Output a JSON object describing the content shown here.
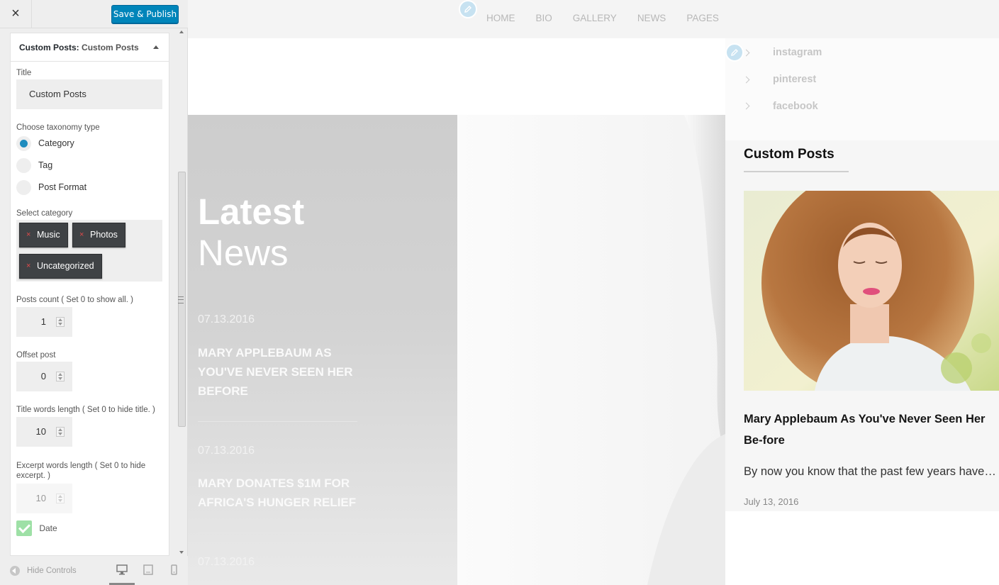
{
  "customizer": {
    "close_icon": "×",
    "publish_label": "Save & Publish",
    "widget_prefix": "Custom Posts:",
    "widget_name": "Custom Posts",
    "title_label": "Title",
    "title_value": "Custom Posts",
    "taxonomy_label": "Choose taxonomy type",
    "taxonomy_options": [
      "Category",
      "Tag",
      "Post Format"
    ],
    "taxonomy_selected": "Category",
    "category_label": "Select category",
    "categories": [
      "Music",
      "Photos",
      "Uncategorized"
    ],
    "chip_remove": "×",
    "posts_count_label": "Posts count ( Set 0 to show all. )",
    "posts_count": "1",
    "offset_label": "Offset post",
    "offset": "0",
    "title_words_label": "Title words length ( Set 0 to hide title. )",
    "title_words": "10",
    "excerpt_words_label": "Excerpt words length ( Set 0 to hide excerpt. )",
    "excerpt_words": "10",
    "date_label": "Date",
    "date_checked": true,
    "hide_controls": "Hide Controls"
  },
  "preview": {
    "nav": [
      "HOME",
      "BIO",
      "GALLERY",
      "NEWS",
      "PAGES"
    ],
    "hero": {
      "title_bold": "Latest",
      "title_light": "News",
      "posts": [
        {
          "date": "07.13.2016",
          "title": "MARY APPLEBAUM AS YOU'VE NEVER SEEN HER BEFORE"
        },
        {
          "date": "07.13.2016",
          "title": "MARY DONATES $1M FOR AFRICA'S HUNGER RELIEF"
        },
        {
          "date": "07.13.2016",
          "title": ""
        }
      ]
    },
    "social": [
      "instagram",
      "pinterest",
      "facebook"
    ],
    "widget": {
      "title": "Custom Posts",
      "post_title": "Mary Applebaum As You've Never Seen Her Be-fore",
      "excerpt": "By now you know that the past few years have…",
      "date": "July 13, 2016"
    }
  },
  "colors": {
    "primary": "#0085ba",
    "radio_selected": "#1e8cbe",
    "chip_bg": "#3f4245",
    "chip_x": "#e04a4a",
    "checkbox": "#9ee0a6",
    "edit_pencil": "#c7e2f1"
  },
  "icons": {
    "close": "close-icon",
    "collapse": "triangle-up-icon",
    "edit": "pencil-icon",
    "hide_controls": "arrow-left-circle-icon",
    "devices": [
      "desktop-icon",
      "tablet-icon",
      "mobile-icon"
    ],
    "social_bullet": "chevron-right-icon"
  }
}
